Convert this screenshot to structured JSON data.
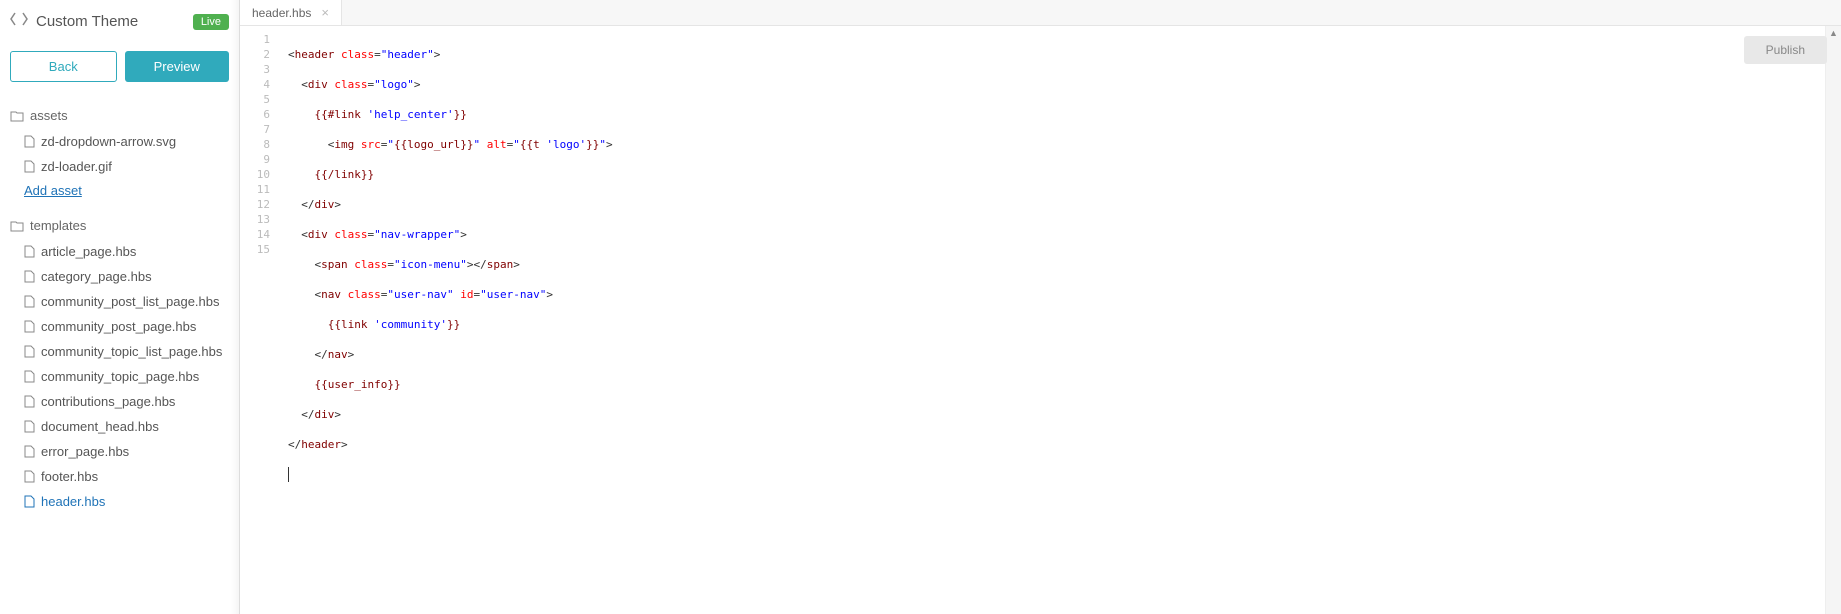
{
  "header": {
    "title": "Custom Theme",
    "badge": "Live",
    "back_label": "Back",
    "preview_label": "Preview"
  },
  "sidebar": {
    "assets_label": "assets",
    "assets": [
      "zd-dropdown-arrow.svg",
      "zd-loader.gif"
    ],
    "add_asset_label": "Add asset",
    "templates_label": "templates",
    "templates": [
      "article_page.hbs",
      "category_page.hbs",
      "community_post_list_page.hbs",
      "community_post_page.hbs",
      "community_topic_list_page.hbs",
      "community_topic_page.hbs",
      "contributions_page.hbs",
      "document_head.hbs",
      "error_page.hbs",
      "footer.hbs",
      "header.hbs"
    ],
    "active_template": "header.hbs"
  },
  "tabs": {
    "open": [
      {
        "label": "header.hbs"
      }
    ]
  },
  "publish_label": "Publish",
  "code": {
    "line_count": 15,
    "lines_raw": [
      "<header class=\"header\">",
      "  <div class=\"logo\">",
      "    {{#link 'help_center'}}",
      "      <img src=\"{{logo_url}}\" alt=\"{{t 'logo'}}\">",
      "    {{/link}}",
      "  </div>",
      "  <div class=\"nav-wrapper\">",
      "    <span class=\"icon-menu\"></span>",
      "    <nav class=\"user-nav\" id=\"user-nav\">",
      "      {{link 'community'}}",
      "    </nav>",
      "    {{user_info}}",
      "  </div>",
      "</header>",
      ""
    ]
  }
}
